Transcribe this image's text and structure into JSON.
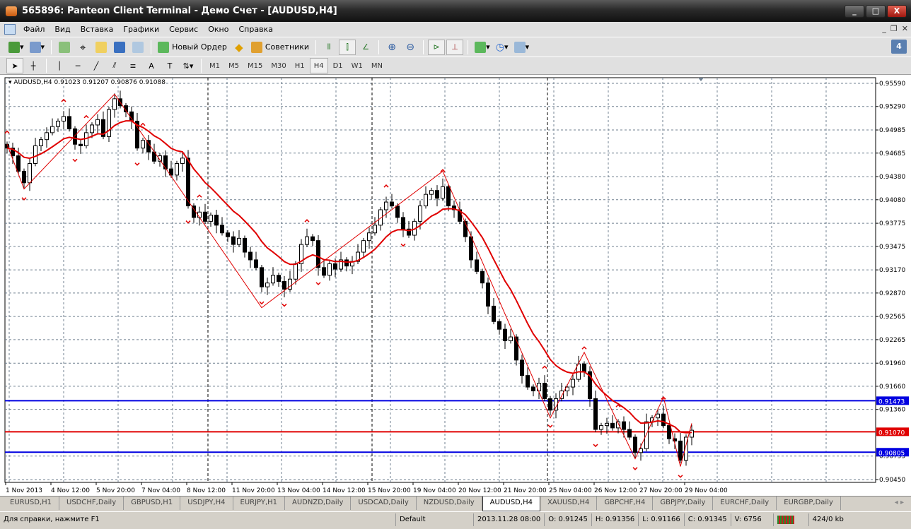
{
  "window": {
    "title": "565896: Panteon Client Terminal - Демо Счет - [AUDUSD,H4]"
  },
  "menu": [
    "Файл",
    "Вид",
    "Вставка",
    "Графики",
    "Сервис",
    "Окно",
    "Справка"
  ],
  "toolbar": {
    "new_order": "Новый Ордер",
    "advisors": "Советники",
    "notifications_count": "4"
  },
  "timeframes": [
    "M1",
    "M5",
    "M15",
    "M30",
    "H1",
    "H4",
    "D1",
    "W1",
    "MN"
  ],
  "active_timeframe": "H4",
  "chart": {
    "legend": "AUDUSD,H4  0.91023 0.91207 0.90876 0.91088"
  },
  "tabs": [
    "EURUSD,H1",
    "USDCHF,Daily",
    "GBPUSD,H1",
    "USDJPY,H4",
    "EURJPY,H1",
    "AUDNZD,Daily",
    "USDCAD,Daily",
    "NZDUSD,Daily",
    "AUDUSD,H4",
    "XAUUSD,H4",
    "GBPCHF,H4",
    "GBPJPY,Daily",
    "EURCHF,Daily",
    "EURGBP,Daily"
  ],
  "active_tab": "AUDUSD,H4",
  "status": {
    "help": "Для справки, нажмите F1",
    "profile": "Default",
    "datetime": "2013.11.28 08:00",
    "open": "O: 0.91245",
    "high": "H: 0.91356",
    "low": "L: 0.91166",
    "close": "C: 0.91345",
    "volume": "V: 6756",
    "traffic": "424/0 kb"
  },
  "colors": {
    "bull": "#ffffff",
    "bear": "#000000",
    "ma": "#e00000",
    "zigzag": "#e00000",
    "level_blue": "#0000e0",
    "level_red": "#e00000",
    "grid": "#708090"
  },
  "chart_data": {
    "type": "candlestick",
    "symbol": "AUDUSD",
    "timeframe": "H4",
    "ylim": [
      0.9045,
      0.9559
    ],
    "y_ticks": [
      "0.95590",
      "0.95290",
      "0.94985",
      "0.94685",
      "0.94380",
      "0.94080",
      "0.93775",
      "0.93475",
      "0.93170",
      "0.92870",
      "0.92565",
      "0.92265",
      "0.91960",
      "0.91660",
      "0.91360",
      "0.90755",
      "0.90450"
    ],
    "x_ticks": [
      "1 Nov 2013",
      "4 Nov 12:00",
      "5 Nov 20:00",
      "7 Nov 04:00",
      "8 Nov 12:00",
      "11 Nov 20:00",
      "13 Nov 04:00",
      "14 Nov 12:00",
      "15 Nov 20:00",
      "19 Nov 04:00",
      "20 Nov 12:00",
      "21 Nov 20:00",
      "25 Nov 04:00",
      "26 Nov 12:00",
      "27 Nov 20:00",
      "29 Nov 04:00"
    ],
    "x_tick_every_bars": 8,
    "closes": [
      0.9475,
      0.9465,
      0.9445,
      0.943,
      0.9455,
      0.9478,
      0.9486,
      0.9495,
      0.9503,
      0.951,
      0.9516,
      0.95,
      0.948,
      0.9478,
      0.9495,
      0.9505,
      0.9512,
      0.949,
      0.9525,
      0.9539,
      0.953,
      0.9522,
      0.951,
      0.9475,
      0.9485,
      0.947,
      0.9458,
      0.9465,
      0.9448,
      0.944,
      0.9455,
      0.9462,
      0.94,
      0.9385,
      0.9392,
      0.938,
      0.9388,
      0.9375,
      0.9365,
      0.936,
      0.935,
      0.9358,
      0.934,
      0.933,
      0.932,
      0.9295,
      0.93,
      0.931,
      0.9302,
      0.9292,
      0.9305,
      0.9325,
      0.935,
      0.936,
      0.9355,
      0.932,
      0.931,
      0.9325,
      0.9318,
      0.933,
      0.9322,
      0.9328,
      0.934,
      0.9355,
      0.9365,
      0.9375,
      0.9395,
      0.9405,
      0.94,
      0.9385,
      0.937,
      0.9362,
      0.938,
      0.94,
      0.9415,
      0.942,
      0.941,
      0.9425,
      0.94,
      0.9395,
      0.938,
      0.936,
      0.933,
      0.9315,
      0.93,
      0.927,
      0.925,
      0.924,
      0.9225,
      0.923,
      0.92,
      0.918,
      0.9165,
      0.916,
      0.917,
      0.915,
      0.9135,
      0.915,
      0.916,
      0.9165,
      0.9175,
      0.9195,
      0.9185,
      0.915,
      0.911,
      0.9115,
      0.9118,
      0.9112,
      0.912,
      0.911,
      0.91,
      0.908,
      0.9085,
      0.912,
      0.9125,
      0.913,
      0.9115,
      0.9098,
      0.9095,
      0.907,
      0.91,
      0.9109
    ],
    "wick": 0.0007,
    "ma_period": 12,
    "zigzag": [
      [
        0,
        0.948
      ],
      [
        3,
        0.9422
      ],
      [
        19,
        0.9545
      ],
      [
        45,
        0.9268
      ],
      [
        77,
        0.9445
      ],
      [
        96,
        0.9125
      ],
      [
        102,
        0.921
      ],
      [
        111,
        0.9072
      ],
      [
        116,
        0.9152
      ],
      [
        119,
        0.9062
      ],
      [
        121,
        0.9118
      ]
    ],
    "fractals_up": [
      0,
      10,
      14,
      19,
      24,
      34,
      53,
      67,
      77,
      95,
      102,
      108,
      116
    ],
    "fractals_down": [
      3,
      12,
      23,
      32,
      45,
      49,
      55,
      70,
      96,
      104,
      111,
      119
    ],
    "levels": [
      {
        "price": 0.91473,
        "label": "0.91473",
        "color": "#0000e0"
      },
      {
        "price": 0.9107,
        "label": "0.91070",
        "color": "#e00000"
      },
      {
        "price": 0.90805,
        "label": "0.90805",
        "color": "#0000e0"
      }
    ],
    "separators_bars": [
      36,
      65,
      96
    ]
  }
}
